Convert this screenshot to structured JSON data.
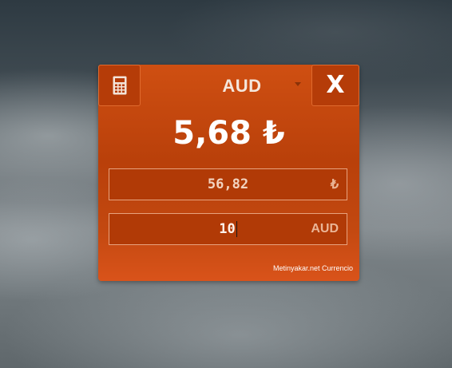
{
  "widget": {
    "selected_currency": "AUD",
    "close_label": "X",
    "result": "5,68 ₺",
    "try_field": {
      "value": "56,82",
      "unit": "₺"
    },
    "aud_field": {
      "value": "10",
      "unit": "AUD"
    },
    "footer": "Metinyakar.net Currencio",
    "icons": {
      "calculator": "calculator-icon",
      "dropdown": "chevron-down-icon"
    },
    "colors": {
      "accent": "#c2450c",
      "button": "#b53c08",
      "text": "#ffffff"
    }
  }
}
